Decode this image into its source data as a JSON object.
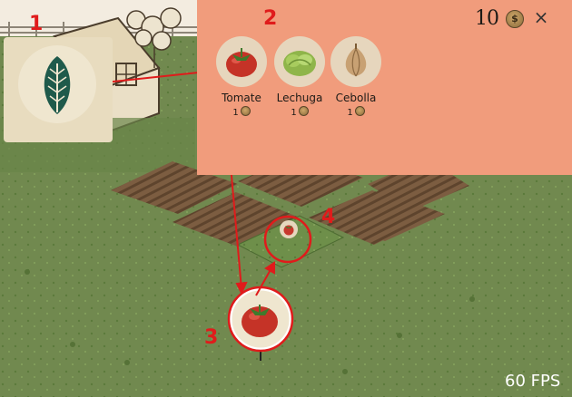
{
  "hud": {
    "coins": "10",
    "coin_symbol": "$",
    "close": "×",
    "fps": "60 FPS"
  },
  "shop": {
    "items": [
      {
        "name": "Tomate",
        "price": "1",
        "icon": "tomato-icon"
      },
      {
        "name": "Lechuga",
        "price": "1",
        "icon": "lettuce-icon"
      },
      {
        "name": "Cebolla",
        "price": "1",
        "icon": "onion-icon"
      }
    ]
  },
  "seed_button": {
    "icon": "leaf-icon"
  },
  "annotations": [
    "1",
    "2",
    "3",
    "4"
  ],
  "colors": {
    "panel": "#f19c7c",
    "annotation": "#e01b1b",
    "grass": "#6f8b4e",
    "soil": "#7a5c3f"
  }
}
